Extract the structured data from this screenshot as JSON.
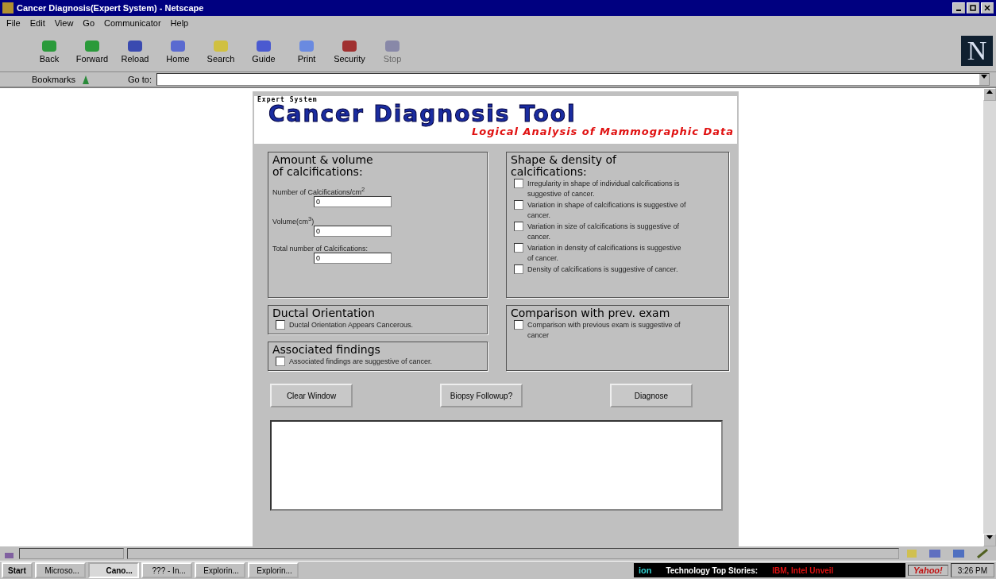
{
  "window": {
    "title": "Cancer Diagnosis(Expert System) - Netscape",
    "logo": "N"
  },
  "menu": [
    "File",
    "Edit",
    "View",
    "Go",
    "Communicator",
    "Help"
  ],
  "toolbar": [
    {
      "label": "Back",
      "disabled": false
    },
    {
      "label": "Forward",
      "disabled": false
    },
    {
      "label": "Reload",
      "disabled": false
    },
    {
      "label": "Home",
      "disabled": false
    },
    {
      "label": "Search",
      "disabled": false
    },
    {
      "label": "Guide",
      "disabled": false
    },
    {
      "label": "Print",
      "disabled": false
    },
    {
      "label": "Security",
      "disabled": false
    },
    {
      "label": "Stop",
      "disabled": true
    }
  ],
  "location": {
    "bookmarks": "Bookmarks",
    "goto": "Go to:"
  },
  "page": {
    "header": {
      "kicker": "Expert System",
      "title": "Cancer Diagnosis Tool",
      "subtitle": "Logical Analysis of Mammographic Data"
    },
    "amount": {
      "title": "Amount & volume of calcifications:",
      "fields": [
        {
          "label": "Number of Calcifications/cm$^{2}$",
          "value": "0"
        },
        {
          "label": "Volume(cm$^{3}$)",
          "value": "0"
        },
        {
          "label": "Total number of Calcifications:",
          "value": "0"
        }
      ]
    },
    "shape": {
      "title": "Shape & density of calcifications:",
      "options": [
        {
          "label": "Irregularity in shape of individual calcifications is suggestive of cancer.",
          "checked": false
        },
        {
          "label": "Variation in shape of calcifications is suggestive of cancer.",
          "checked": false
        },
        {
          "label": "Variation in size of calcifications is suggestive of cancer.",
          "checked": false
        },
        {
          "label": "Variation in density of calcifications is suggestive of cancer.",
          "checked": false
        },
        {
          "label": "Density of calcifications is suggestive of cancer.",
          "checked": false
        }
      ]
    },
    "ductal": {
      "title": "Ductal Orientation",
      "option": {
        "label": "Ductal Orientation Appears Cancerous.",
        "checked": false
      }
    },
    "associated": {
      "title": "Associated findings",
      "option": {
        "label": "Associated findings are suggestive of cancer.",
        "checked": false
      }
    },
    "comparison": {
      "title": "Comparison with prev. exam",
      "option": {
        "label": "Comparison with previous exam is suggestive of cancer",
        "checked": false
      }
    },
    "buttons": [
      "Clear Window",
      "Biopsy Followup?",
      "Diagnose"
    ]
  },
  "taskbar": {
    "start": "Start",
    "items": [
      {
        "label": "Microso...",
        "selected": false
      },
      {
        "label": "Cano...",
        "selected": true
      },
      {
        "label": "??? - In...",
        "selected": false
      },
      {
        "label": "Explorin...",
        "selected": false
      },
      {
        "label": "Explorin...",
        "selected": false
      }
    ],
    "ticker": {
      "brand": "ion",
      "headline": "Technology Top Stories:",
      "story": "IBM, Intel Unveil"
    },
    "yahoo": "Yahoo!",
    "time": "3:26 PM"
  }
}
